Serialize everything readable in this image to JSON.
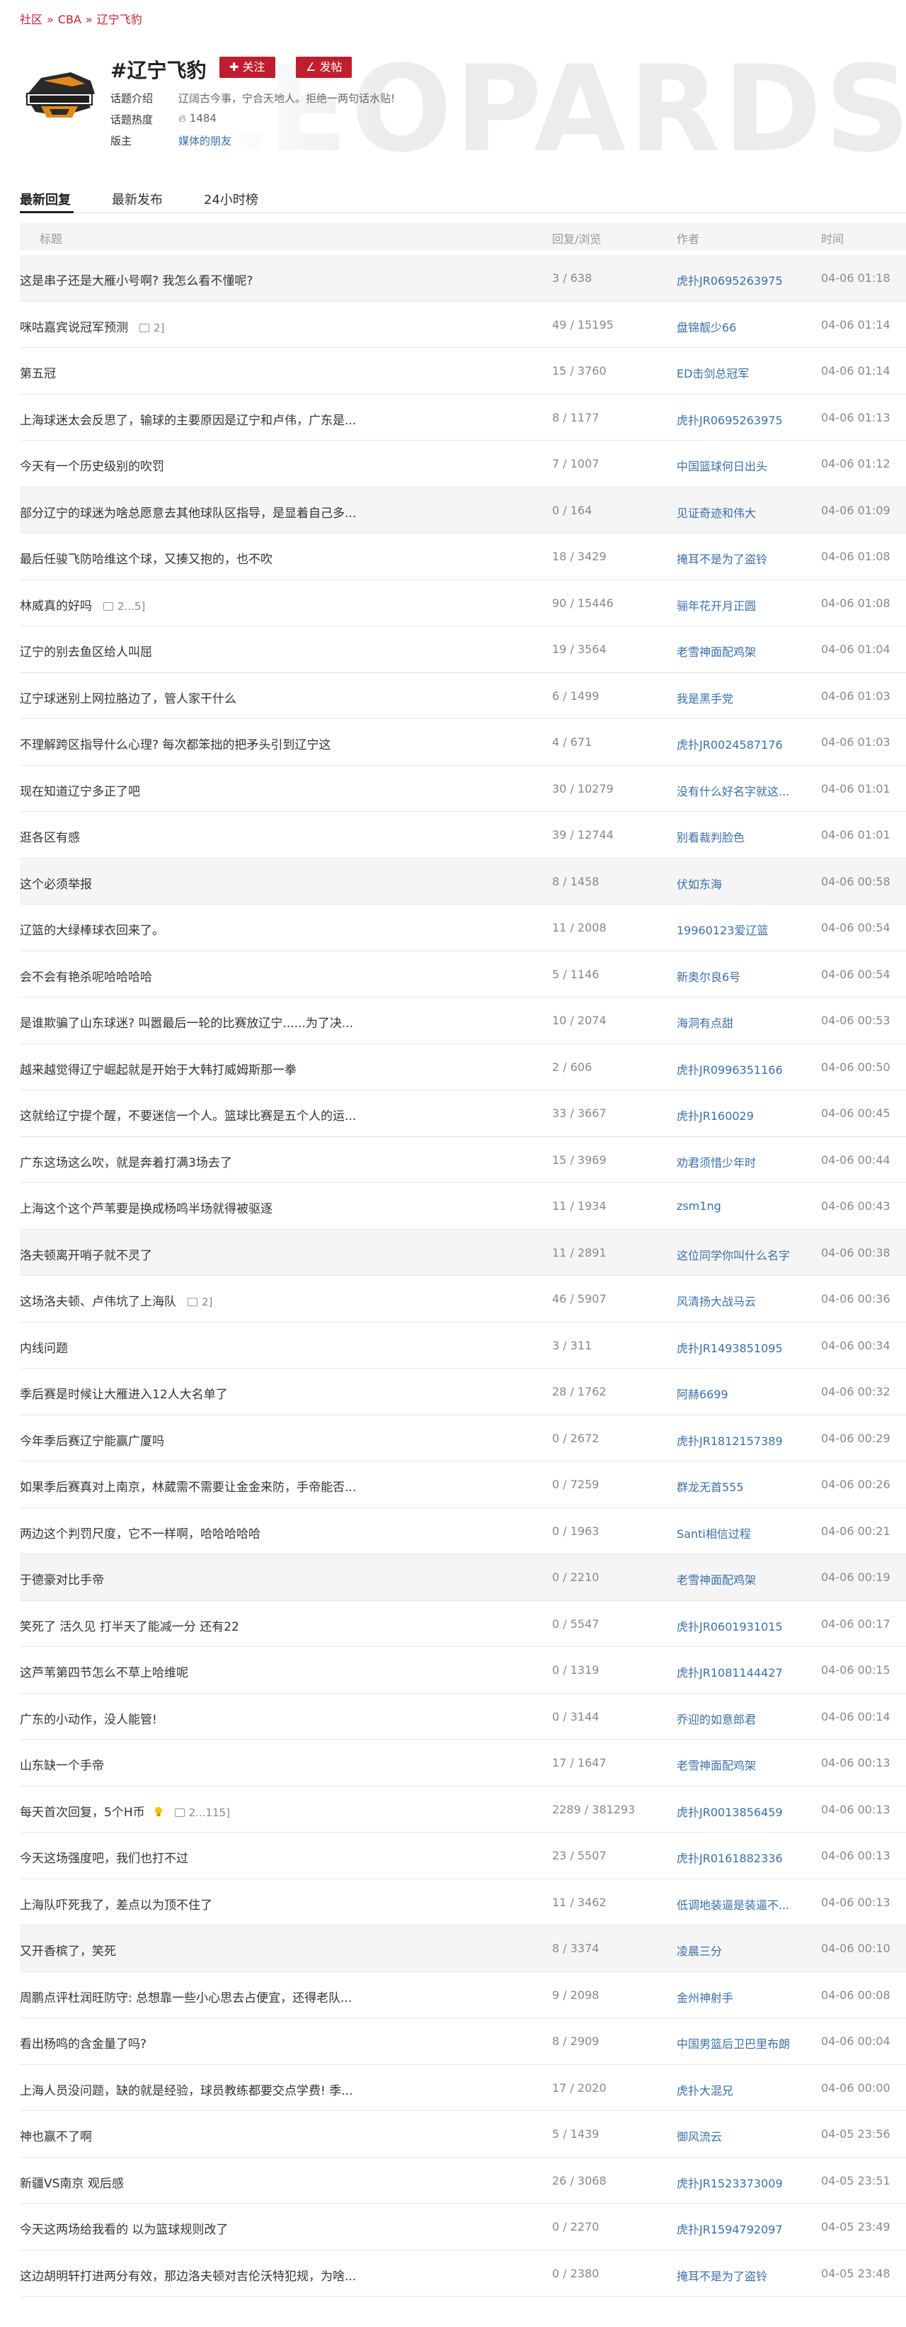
{
  "breadcrumb": [
    "社区",
    "CBA",
    "辽宁飞豹"
  ],
  "topic": {
    "title": "#辽宁飞豹",
    "follow_label": "关注",
    "post_label": "发帖",
    "intro_label": "话题介绍",
    "intro": "辽阔古今事，宁合天地人。拒绝一两句话水贴!",
    "heat_label": "话题热度",
    "heat": "1484",
    "host_label": "版主",
    "host": "媒体的朋友",
    "banner_word": "LEOPARDS"
  },
  "tabs": [
    "最新回复",
    "最新发布",
    "24小时榜"
  ],
  "columns": [
    "标题",
    "回复/浏览",
    "作者",
    "时间"
  ],
  "rows": [
    {
      "title": "这是串子还是大雁小号啊? 我怎么看不懂呢?",
      "pages": "",
      "counts": "3 / 638",
      "author": "虎扑JR0695263975",
      "time": "04-06 01:18",
      "alt": true
    },
    {
      "title": "咪咕嘉宾说冠军预测",
      "pages": "2]",
      "counts": "49 / 15195",
      "author": "盘锦靓少66",
      "time": "04-06 01:14",
      "alt": false
    },
    {
      "title": "第五冠",
      "pages": "",
      "counts": "15 / 3760",
      "author": "ED击剑总冠军",
      "time": "04-06 01:14",
      "alt": false
    },
    {
      "title": "上海球迷太会反思了，输球的主要原因是辽宁和卢伟，广东是...",
      "pages": "",
      "counts": "8 / 1177",
      "author": "虎扑JR0695263975",
      "time": "04-06 01:13",
      "alt": false
    },
    {
      "title": "今天有一个历史级别的吹罚",
      "pages": "",
      "counts": "7 / 1007",
      "author": "中国篮球何日出头",
      "time": "04-06 01:12",
      "alt": false
    },
    {
      "title": "部分辽宁的球迷为啥总愿意去其他球队区指导，是显着自己多...",
      "pages": "",
      "counts": "0 / 164",
      "author": "见证奇迹和伟大",
      "time": "04-06 01:09",
      "alt": true
    },
    {
      "title": "最后任骏飞防哈维这个球，又揍又抱的，也不吹",
      "pages": "",
      "counts": "18 / 3429",
      "author": "掩耳不是为了盗铃",
      "time": "04-06 01:08",
      "alt": false
    },
    {
      "title": "林威真的好吗",
      "pages": "2...5]",
      "counts": "90 / 15446",
      "author": "骊年花开月正圆",
      "time": "04-06 01:08",
      "alt": false
    },
    {
      "title": "辽宁的别去鱼区给人叫屈",
      "pages": "",
      "counts": "19 / 3564",
      "author": "老雪神面配鸡架",
      "time": "04-06 01:04",
      "alt": false
    },
    {
      "title": "辽宁球迷别上网拉胳边了，管人家干什么",
      "pages": "",
      "counts": "6 / 1499",
      "author": "我是黑手党",
      "time": "04-06 01:03",
      "alt": false
    },
    {
      "title": "不理解跨区指导什么心理? 每次都笨拙的把矛头引到辽宁这",
      "pages": "",
      "counts": "4 / 671",
      "author": "虎扑JR0024587176",
      "time": "04-06 01:03",
      "alt": false
    },
    {
      "title": "现在知道辽宁多正了吧",
      "pages": "",
      "counts": "30 / 10279",
      "author": "没有什么好名字就这...",
      "time": "04-06 01:01",
      "alt": false
    },
    {
      "title": "逛各区有感",
      "pages": "",
      "counts": "39 / 12744",
      "author": "别看裁判脸色",
      "time": "04-06 01:01",
      "alt": false
    },
    {
      "title": "这个必须举报",
      "pages": "",
      "counts": "8 / 1458",
      "author": "伏如东海",
      "time": "04-06 00:58",
      "alt": true
    },
    {
      "title": "辽篮的大绿棒球衣回来了。",
      "pages": "",
      "counts": "11 / 2008",
      "author": "19960123爱辽篮",
      "time": "04-06 00:54",
      "alt": false
    },
    {
      "title": "会不会有艳杀呢哈哈哈哈",
      "pages": "",
      "counts": "5 / 1146",
      "author": "新奥尔良6号",
      "time": "04-06 00:54",
      "alt": false
    },
    {
      "title": "是谁欺骗了山东球迷? 叫嚣最后一轮的比赛放辽宁......为了决...",
      "pages": "",
      "counts": "10 / 2074",
      "author": "海洞有点甜",
      "time": "04-06 00:53",
      "alt": false
    },
    {
      "title": "越来越觉得辽宁崛起就是开始于大韩打威姆斯那一拳",
      "pages": "",
      "counts": "2 / 606",
      "author": "虎扑JR0996351166",
      "time": "04-06 00:50",
      "alt": false
    },
    {
      "title": "这就给辽宁提个醒，不要迷信一个人。篮球比赛是五个人的运...",
      "pages": "",
      "counts": "33 / 3667",
      "author": "虎扑JR160029",
      "time": "04-06 00:45",
      "alt": false
    },
    {
      "title": "广东这场这么吹，就是奔着打满3场去了",
      "pages": "",
      "counts": "15 / 3969",
      "author": "劝君须惜少年时",
      "time": "04-06 00:44",
      "alt": false
    },
    {
      "title": "上海这个这个芦苇要是换成杨鸣半场就得被驱逐",
      "pages": "",
      "counts": "11 / 1934",
      "author": "zsm1ng",
      "time": "04-06 00:43",
      "alt": false
    },
    {
      "title": "洛夫顿离开哨子就不灵了",
      "pages": "",
      "counts": "11 / 2891",
      "author": "这位同学你叫什么名字",
      "time": "04-06 00:38",
      "alt": true
    },
    {
      "title": "这场洛夫顿、卢伟坑了上海队",
      "pages": "2]",
      "counts": "46 / 5907",
      "author": "风清扬大战马云",
      "time": "04-06 00:36",
      "alt": false
    },
    {
      "title": "内线问题",
      "pages": "",
      "counts": "3 / 311",
      "author": "虎扑JR1493851095",
      "time": "04-06 00:34",
      "alt": false
    },
    {
      "title": "季后赛是时候让大雁进入12人大名单了",
      "pages": "",
      "counts": "28 / 1762",
      "author": "阿赫6699",
      "time": "04-06 00:32",
      "alt": false
    },
    {
      "title": "今年季后赛辽宁能赢广厦吗",
      "pages": "",
      "counts": "0 / 2672",
      "author": "虎扑JR1812157389",
      "time": "04-06 00:29",
      "alt": false
    },
    {
      "title": "如果季后赛真对上南京，林葳需不需要让金金来防，手帝能否...",
      "pages": "",
      "counts": "0 / 7259",
      "author": "群龙无首555",
      "time": "04-06 00:26",
      "alt": false
    },
    {
      "title": "两边这个判罚尺度，它不一样啊，哈哈哈哈哈",
      "pages": "",
      "counts": "0 / 1963",
      "author": "Santi相信过程",
      "time": "04-06 00:21",
      "alt": false
    },
    {
      "title": "于德豪对比手帝",
      "pages": "",
      "counts": "0 / 2210",
      "author": "老雪神面配鸡架",
      "time": "04-06 00:19",
      "alt": true
    },
    {
      "title": "笑死了 活久见 打半天了能减一分 还有22",
      "pages": "",
      "counts": "0 / 5547",
      "author": "虎扑JR0601931015",
      "time": "04-06 00:17",
      "alt": false
    },
    {
      "title": "这芦苇第四节怎么不草上哈维呢",
      "pages": "",
      "counts": "0 / 1319",
      "author": "虎扑JR1081144427",
      "time": "04-06 00:15",
      "alt": false
    },
    {
      "title": "广东的小动作，没人能管!",
      "pages": "",
      "counts": "0 / 3144",
      "author": "乔迎的如意郎君",
      "time": "04-06 00:14",
      "alt": false
    },
    {
      "title": "山东缺一个手帝",
      "pages": "",
      "counts": "17 / 1647",
      "author": "老雪神面配鸡架",
      "time": "04-06 00:13",
      "alt": false
    },
    {
      "title": "每天首次回复，5个H币",
      "pages": "2...115]",
      "counts": "2289 / 381293",
      "author": "虎扑JR0013856459",
      "time": "04-06 00:13",
      "alt": false,
      "bulb": true
    },
    {
      "title": "今天这场强度吧，我们也打不过",
      "pages": "",
      "counts": "23 / 5507",
      "author": "虎扑JR0161882336",
      "time": "04-06 00:13",
      "alt": false
    },
    {
      "title": "上海队吓死我了，差点以为顶不住了",
      "pages": "",
      "counts": "11 / 3462",
      "author": "低调地装逼是装逼不...",
      "time": "04-06 00:13",
      "alt": false
    },
    {
      "title": "又开香槟了，笑死",
      "pages": "",
      "counts": "8 / 3374",
      "author": "凌晨三分",
      "time": "04-06 00:10",
      "alt": true
    },
    {
      "title": "周鹏点评杜润旺防守: 总想靠一些小心思去占便宜，还得老队...",
      "pages": "",
      "counts": "9 / 2098",
      "author": "金州神射手",
      "time": "04-06 00:08",
      "alt": false
    },
    {
      "title": "看出杨鸣的含金量了吗?",
      "pages": "",
      "counts": "8 / 2909",
      "author": "中国男篮后卫巴里布朗",
      "time": "04-06 00:04",
      "alt": false
    },
    {
      "title": "上海人员没问题，缺的就是经验，球员教练都要交点学费! 季...",
      "pages": "",
      "counts": "17 / 2020",
      "author": "虎扑大混兄",
      "time": "04-06 00:00",
      "alt": false
    },
    {
      "title": "神也赢不了啊",
      "pages": "",
      "counts": "5 / 1439",
      "author": "御风流云",
      "time": "04-05 23:56",
      "alt": false
    },
    {
      "title": "新疆VS南京 观后感",
      "pages": "",
      "counts": "26 / 3068",
      "author": "虎扑JR1523373009",
      "time": "04-05 23:51",
      "alt": false
    },
    {
      "title": "今天这两场给我看的 以为篮球规则改了",
      "pages": "",
      "counts": "0 / 2270",
      "author": "虎扑JR1594792097",
      "time": "04-05 23:49",
      "alt": false
    },
    {
      "title": "这边胡明轩打进两分有效，那边洛夫顿对吉伦沃特犯规，为啥...",
      "pages": "",
      "counts": "0 / 2380",
      "author": "掩耳不是为了盗铃",
      "time": "04-05 23:48",
      "alt": false
    }
  ],
  "colors": {
    "accent": "#c01e2f",
    "link": "#3a6fa8"
  }
}
